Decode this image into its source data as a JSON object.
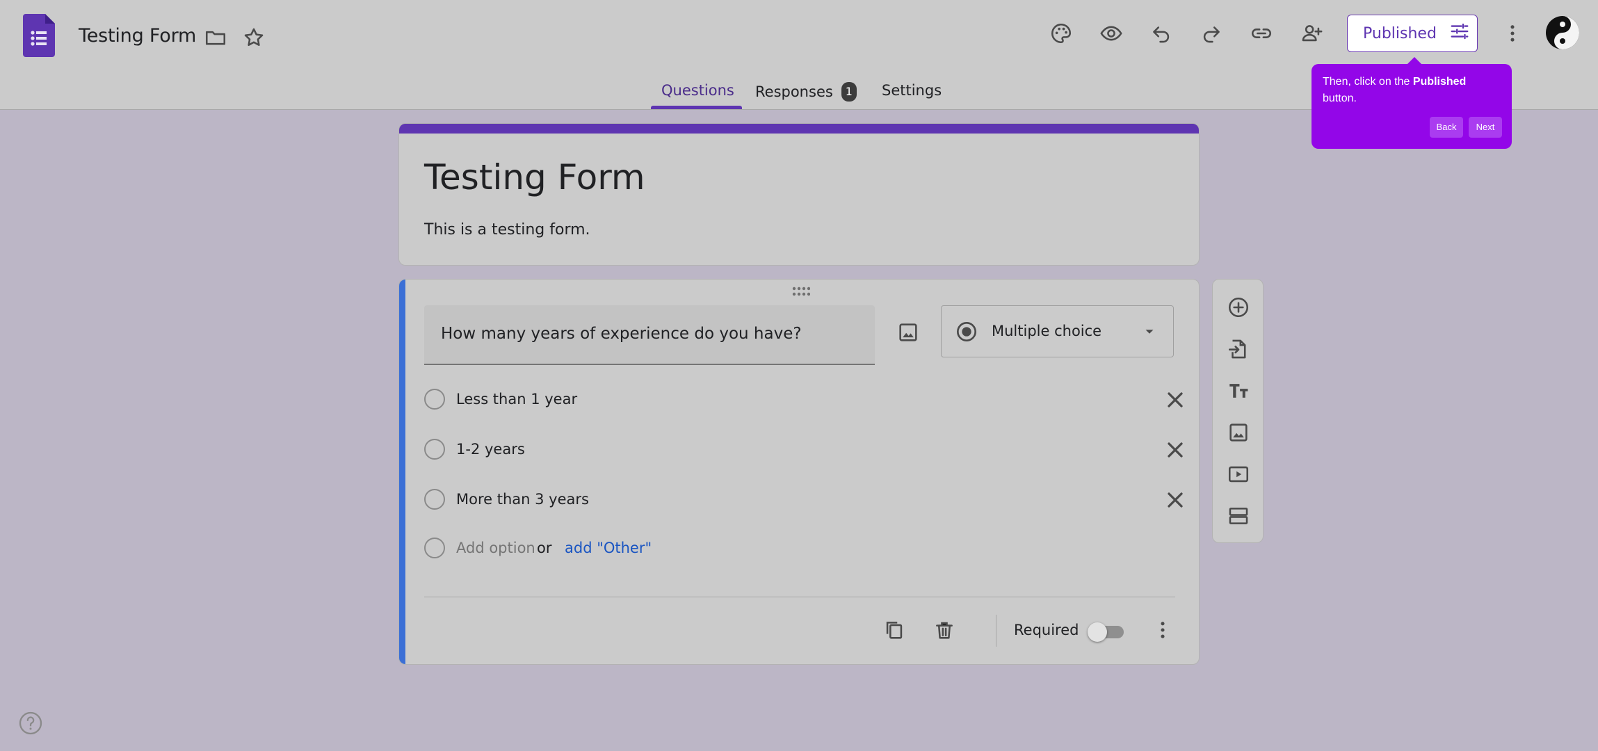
{
  "header": {
    "doc_title": "Testing Form",
    "published_label": "Published"
  },
  "tabs": [
    {
      "label": "Questions",
      "active": true
    },
    {
      "label": "Responses",
      "badge": "1"
    },
    {
      "label": "Settings"
    }
  ],
  "tooltip": {
    "text_before": "Then, click on the ",
    "text_bold": "Published",
    "text_after": " button.",
    "back_label": "Back",
    "next_label": "Next"
  },
  "form": {
    "title": "Testing Form",
    "description": "This is a testing form."
  },
  "question": {
    "text": "How many years of experience do you have?",
    "type_label": "Multiple choice",
    "options": [
      "Less than 1 year",
      "1-2 years",
      "More than 3 years"
    ],
    "add_option_label": "Add option",
    "or_label": "or",
    "add_other_label": "add \"Other\"",
    "required_label": "Required",
    "required": false
  },
  "colors": {
    "accent": "#5e35b1",
    "question_strip": "#3b6fd6",
    "tooltip_bg": "#9306e8",
    "link": "#1a55c2"
  },
  "icons": {
    "header": [
      "forms-logo-icon",
      "folder-icon",
      "star-icon",
      "palette-icon",
      "preview-eye-icon",
      "undo-icon",
      "redo-icon",
      "link-icon",
      "add-collaborator-icon",
      "tune-icon",
      "more-vert-icon"
    ],
    "side_toolbar": [
      "add-question-icon",
      "import-questions-icon",
      "add-title-icon",
      "add-image-icon",
      "add-video-icon",
      "add-section-icon"
    ]
  }
}
